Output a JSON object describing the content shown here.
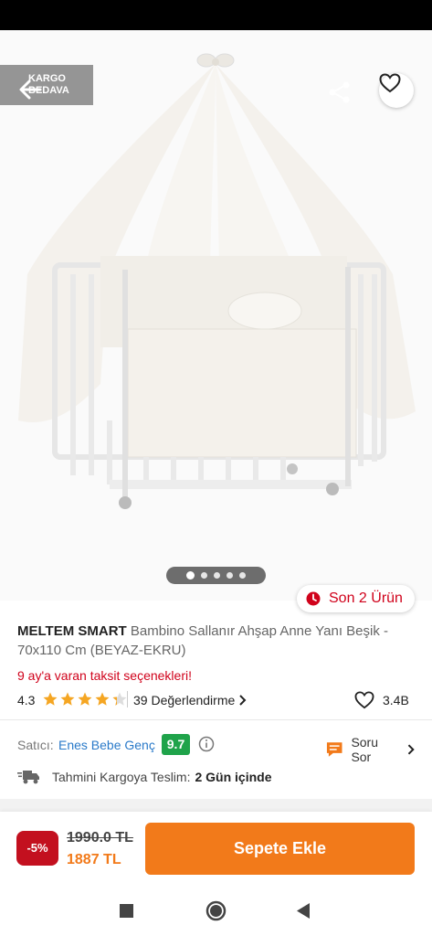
{
  "header": {
    "badge_line1": "KARGO",
    "badge_line2": "BEDAVA",
    "back_icon": "arrow-left-icon",
    "share_icon": "share-icon",
    "favorite_icon": "heart-outline-icon"
  },
  "gallery": {
    "image_subject": "white canopy crib",
    "dot_count": 5,
    "active_index": 0
  },
  "stock": {
    "label": "Son 2 Ürün",
    "icon": "clock-icon"
  },
  "product": {
    "brand": "MELTEM SMART",
    "name": "Bambino Sallanır Ahşap Anne Yanı Beşik - 70x110 Cm (BEYAZ-EKRU)",
    "installment_text": "9 ay'a varan taksit seçenekleri!"
  },
  "rating": {
    "score": "4.3",
    "stars_value": 4.3,
    "reviews": "39 Değerlendirme",
    "likes": "3.4B"
  },
  "seller": {
    "label": "Satıcı:",
    "name": "Enes Bebe Genç",
    "score": "9.7",
    "ask_label": "Soru Sor"
  },
  "shipping": {
    "label": "Tahmini Kargoya Teslim:",
    "value": "2 Gün içinde"
  },
  "purchase": {
    "discount": "-5%",
    "old_price": "1990.0 TL",
    "new_price": "1887 TL",
    "add_to_cart": "Sepete Ekle"
  },
  "colors": {
    "brand_orange": "#f27a1a",
    "alert_red": "#d0021b",
    "star_gold": "#f5a623",
    "seller_green": "#1fa34a",
    "link_blue": "#2a7ac9"
  }
}
